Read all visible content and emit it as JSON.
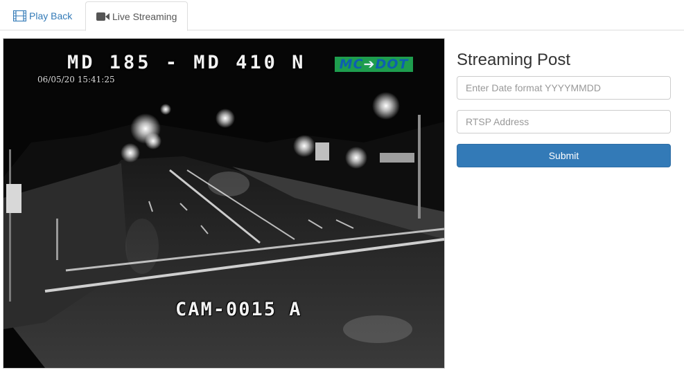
{
  "tabs": {
    "playback": {
      "label": "Play Back",
      "icon": "film-icon"
    },
    "live": {
      "label": "Live Streaming",
      "icon": "video-camera-icon",
      "active": true
    }
  },
  "video": {
    "overlay_title": "MD 185 - MD 410 N",
    "overlay_timestamp": "06/05/20 15:41:25",
    "overlay_camera": "CAM-0015 A",
    "logo_text_left": "MC",
    "logo_text_right": "DOT"
  },
  "form": {
    "title": "Streaming Post",
    "date_placeholder": "Enter Date format YYYYMMDD",
    "rtsp_placeholder": "RTSP Address",
    "submit_label": "Submit"
  },
  "colors": {
    "link": "#337ab7",
    "primary_button": "#337ab7",
    "border": "#dddddd"
  }
}
